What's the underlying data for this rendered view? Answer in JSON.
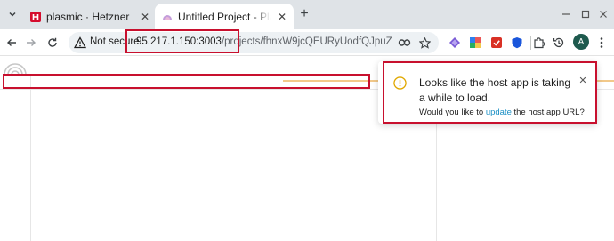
{
  "tabs": [
    {
      "title": "plasmic · Hetzner Cloud",
      "favicon": "hetzner-icon",
      "active": false
    },
    {
      "title": "Untitled Project - Plasmic",
      "favicon": "plasmic-icon",
      "active": true
    }
  ],
  "toolbar": {
    "security_label": "Not secure",
    "url_host": "95.217.1.150:3003",
    "url_path": "/projects/fhnxW9jcQEURyUodfQJpuZ",
    "avatar_letter": "A"
  },
  "toast": {
    "title": "Looks like the host app is taking a while to load.",
    "sub_prefix": "Would you like to ",
    "sub_link": "update",
    "sub_suffix": " the host app URL?"
  },
  "colors": {
    "annotation": "#c8102e",
    "warning": "#e0a800",
    "link": "#1a8fc4",
    "tabstrip": "#dfe3e7"
  }
}
